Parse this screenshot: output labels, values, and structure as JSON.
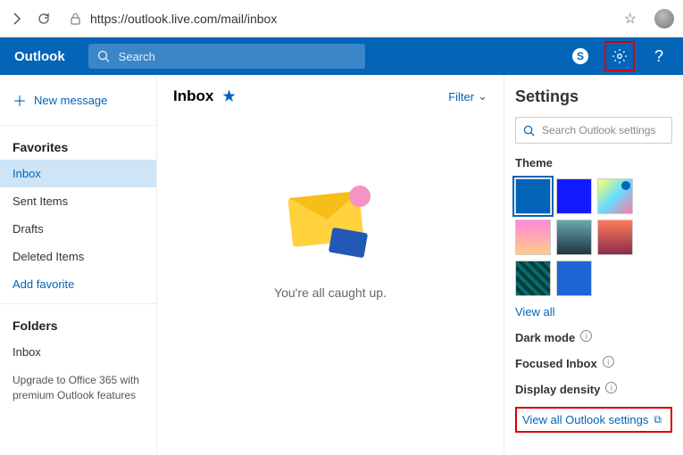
{
  "browser": {
    "url": "https://outlook.live.com/mail/inbox"
  },
  "header": {
    "brand": "Outlook",
    "search_placeholder": "Search"
  },
  "sidebar": {
    "new_message": "New message",
    "favorites_title": "Favorites",
    "favorites": [
      {
        "label": "Inbox",
        "active": true
      },
      {
        "label": "Sent Items",
        "active": false
      },
      {
        "label": "Drafts",
        "active": false
      },
      {
        "label": "Deleted Items",
        "active": false
      }
    ],
    "add_favorite": "Add favorite",
    "folders_title": "Folders",
    "folders": [
      {
        "label": "Inbox"
      }
    ],
    "upgrade_text": "Upgrade to Office 365 with premium Outlook features"
  },
  "inbox": {
    "title": "Inbox",
    "filter_label": "Filter",
    "empty_message": "You're all caught up."
  },
  "settings": {
    "title": "Settings",
    "search_placeholder": "Search Outlook settings",
    "theme_label": "Theme",
    "view_all": "View all",
    "dark_mode": "Dark mode",
    "focused_inbox": "Focused Inbox",
    "display_density": "Display density",
    "view_all_settings": "View all Outlook settings"
  }
}
